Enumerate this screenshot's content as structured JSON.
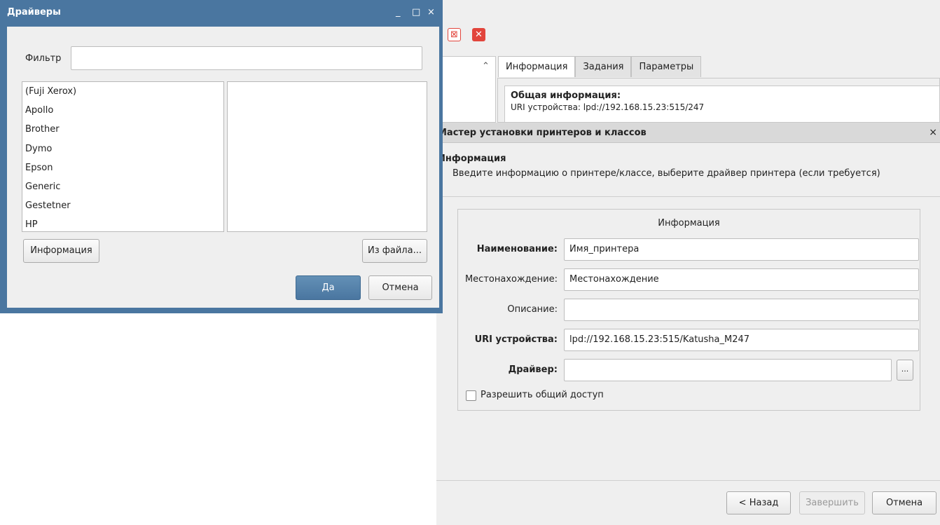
{
  "background_window": {
    "toolbar_icons": [
      "cancel-outline-icon",
      "cancel-filled-icon"
    ],
    "tabs": [
      "Информация",
      "Задания",
      "Параметры"
    ],
    "info_heading": "Общая информация:",
    "info_uri": "URI устройства: lpd://192.168.15.23:515/247"
  },
  "wizard": {
    "title": "Мастер установки принтеров и классов",
    "close": "×",
    "section_title": "Информация",
    "section_desc": "Введите информацию о принтере/классе, выберите драйвер принтера (если требуется)",
    "group_title": "Информация",
    "fields": {
      "name_label": "Наименование:",
      "name_value": "Имя_принтера",
      "location_label": "Местонахождение:",
      "location_value": "Местонахождение",
      "description_label": "Описание:",
      "description_value": "",
      "uri_label": "URI устройства:",
      "uri_value": "lpd://192.168.15.23:515/Katusha_M247",
      "driver_label": "Драйвер:",
      "driver_value": "",
      "browse_label": "..."
    },
    "share_label": "Разрешить общий доступ",
    "share_checked": false,
    "buttons": {
      "back": "< Назад",
      "finish": "Завершить",
      "cancel": "Отмена"
    }
  },
  "drivers_dialog": {
    "title": "Драйверы",
    "controls": {
      "minimize": "_",
      "maximize": "□",
      "close": "×"
    },
    "filter_label": "Фильтр",
    "filter_value": "",
    "vendors": [
      "(Fuji Xerox)",
      "Apollo",
      "Brother",
      "Dymo",
      "Epson",
      "Generic",
      "Gestetner",
      "HP"
    ],
    "buttons": {
      "info": "Информация",
      "from_file": "Из файла...",
      "ok": "Да",
      "cancel": "Отмена"
    }
  },
  "colors": {
    "accent": "#4a76a0",
    "danger": "#e2453c",
    "window_bg": "#efefef"
  }
}
